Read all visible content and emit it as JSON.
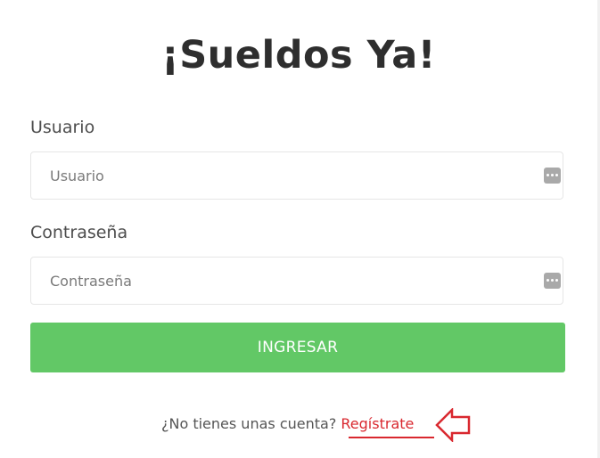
{
  "title": "¡Sueldos Ya!",
  "form": {
    "user_label": "Usuario",
    "user_placeholder": "Usuario",
    "password_label": "Contraseña",
    "password_placeholder": "Contraseña",
    "submit_label": "INGRESAR"
  },
  "register": {
    "prompt": "¿No tienes unas cuenta?",
    "link_label": "Regístrate"
  },
  "colors": {
    "submit_button": "#62c866",
    "link": "#d9282f",
    "annotation": "#d9282f"
  },
  "icons": {
    "password_manager": "more-dots-icon",
    "annotation": "left-arrow-icon"
  }
}
